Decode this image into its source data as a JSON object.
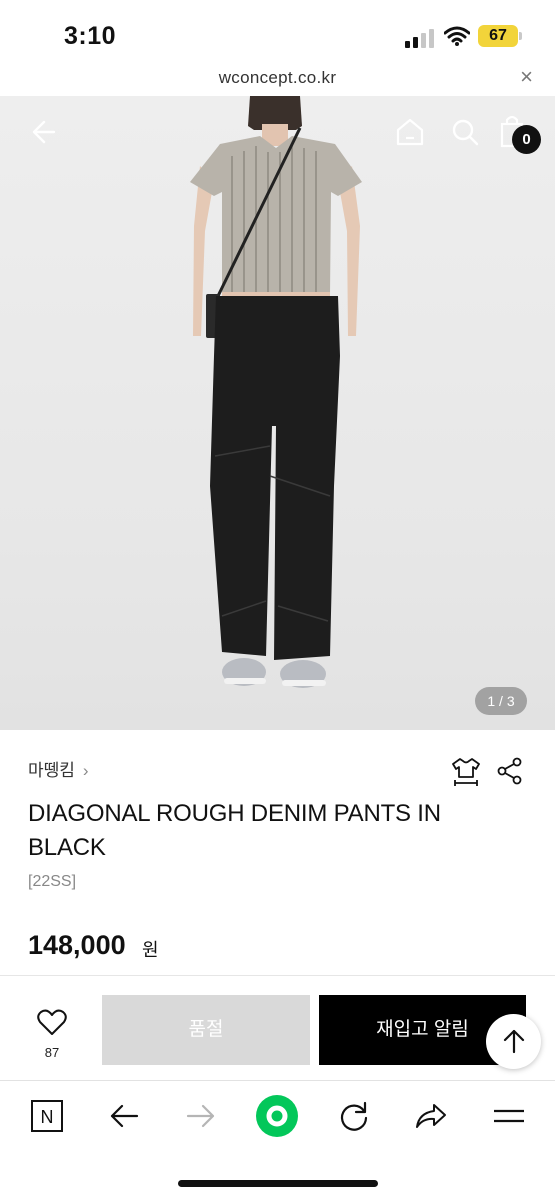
{
  "status_bar": {
    "time": "3:10",
    "battery": "67"
  },
  "url_bar": {
    "url": "wconcept.co.kr",
    "close_glyph": "×"
  },
  "hero": {
    "page_indicator": "1 / 3",
    "cart_count": "0",
    "icons": [
      "back-arrow-icon",
      "home-icon",
      "search-icon",
      "shopping-bag-icon"
    ]
  },
  "product": {
    "brand": "마뗑킴",
    "brand_chevron": "›",
    "title": "DIAGONAL ROUGH DENIM PANTS IN BLACK",
    "season": "[22SS]",
    "price": "148,000",
    "price_unit": "원"
  },
  "purchase_bar": {
    "wish_count": "87",
    "soldout_label": "품절",
    "restock_label": "재입고 알림"
  },
  "toolbar": {
    "icons": [
      "naver-n-icon",
      "back-icon",
      "forward-icon",
      "green-record-icon",
      "reload-icon",
      "share-icon",
      "menu-icon"
    ],
    "naver_label": "N",
    "accent_green": "#03c75a"
  }
}
